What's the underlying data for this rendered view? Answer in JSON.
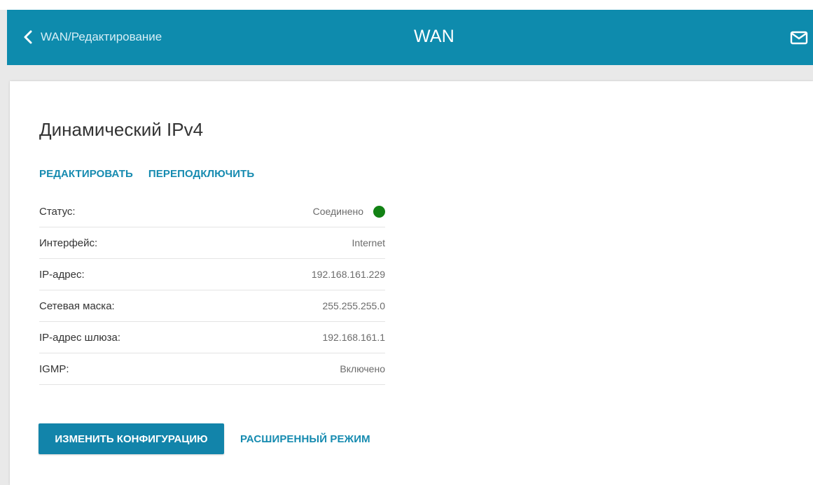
{
  "header": {
    "back_label": "WAN/Редактирование",
    "title": "WAN",
    "back_icon": "chevron-left-icon",
    "mail_icon": "mail-icon"
  },
  "page": {
    "title": "Динамический IPv4",
    "actions": {
      "edit": "РЕДАКТИРОВАТЬ",
      "reconnect": "ПЕРЕПОДКЛЮЧИТЬ"
    },
    "rows": [
      {
        "label": "Статус:",
        "value": "Соединено"
      },
      {
        "label": "Интерфейс:",
        "value": "Internet"
      },
      {
        "label": "IP-адрес:",
        "value": "192.168.161.229"
      },
      {
        "label": "Сетевая маска:",
        "value": "255.255.255.0"
      },
      {
        "label": "IP-адрес шлюза:",
        "value": "192.168.161.1"
      },
      {
        "label": "IGMP:",
        "value": "Включено"
      }
    ],
    "buttons": {
      "change_config": "ИЗМЕНИТЬ КОНФИГУРАЦИЮ",
      "advanced_mode": "РАСШИРЕННЫЙ РЕЖИМ"
    }
  },
  "colors": {
    "header_bg": "#0e8bad",
    "accent": "#168bb0",
    "status_ok": "#128214",
    "button_bg": "#1284aa"
  }
}
